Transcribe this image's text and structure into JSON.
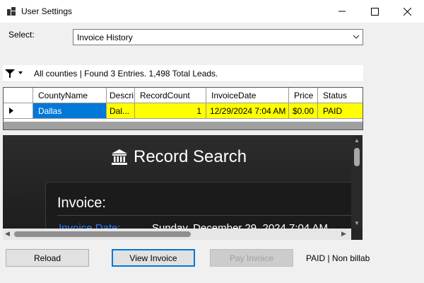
{
  "window": {
    "title": "User Settings",
    "controls": {
      "minimize": "minimize-icon",
      "maximize": "maximize-icon",
      "close": "close-icon"
    }
  },
  "select": {
    "label": "Select:",
    "value": "Invoice History"
  },
  "filter": {
    "summary": "All counties | Found 3 Entries. 1,498 Total Leads."
  },
  "grid": {
    "columns": [
      "CountyName",
      "Descri",
      "RecordCount",
      "InvoiceDate",
      "Price",
      "Status"
    ],
    "rows": [
      {
        "CountyName": "Dallas",
        "Description": "Dal...",
        "RecordCount": "1",
        "InvoiceDate": "12/29/2024 7:04 AM",
        "Price": "$0.00",
        "Status": "PAID"
      }
    ]
  },
  "browser": {
    "heading": "Record Search",
    "invoice_title": "Invoice:",
    "invoice_date_label": "Invoice Date:",
    "invoice_date_value": "Sunday, December 29, 2024 7:04 AM"
  },
  "buttons": {
    "reload": "Reload",
    "view_invoice": "View Invoice",
    "pay_invoice": "Pay Invoice"
  },
  "status": "PAID | Non billab",
  "colors": {
    "row_highlight": "#ffff00",
    "selection": "#0078d7",
    "link": "#2b7fff",
    "page_dark": "#262626"
  }
}
